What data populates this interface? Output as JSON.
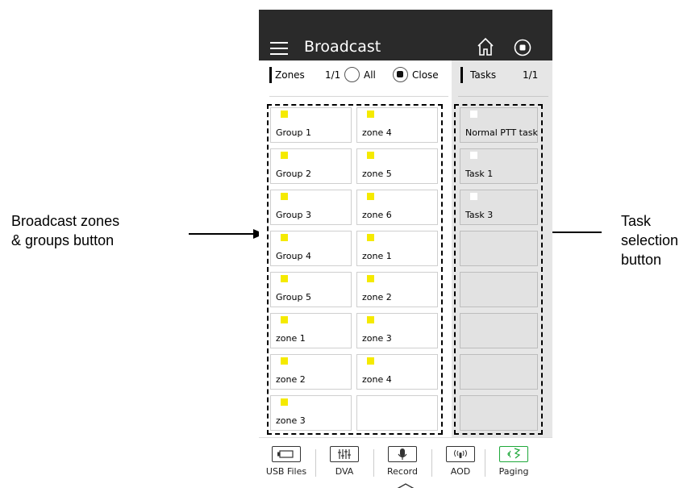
{
  "app": {
    "title": "Broadcast"
  },
  "zones_header": {
    "label": "Zones",
    "page": "1/1",
    "all_label": "All",
    "close_label": "Close"
  },
  "tasks_header": {
    "label": "Tasks",
    "page": "1/1"
  },
  "zone_buttons": [
    {
      "label": "Group 1",
      "indicator_color": "#f5ea00"
    },
    {
      "label": "zone 4",
      "indicator_color": "#f5ea00"
    },
    {
      "label": "Group 2",
      "indicator_color": "#f5ea00"
    },
    {
      "label": "zone 5",
      "indicator_color": "#f5ea00"
    },
    {
      "label": "Group 3",
      "indicator_color": "#f5ea00"
    },
    {
      "label": "zone 6",
      "indicator_color": "#f5ea00"
    },
    {
      "label": "Group 4",
      "indicator_color": "#f5ea00"
    },
    {
      "label": "zone 1",
      "indicator_color": "#f5ea00"
    },
    {
      "label": "Group 5",
      "indicator_color": "#f5ea00"
    },
    {
      "label": "zone 2",
      "indicator_color": "#f5ea00"
    },
    {
      "label": "zone 1",
      "indicator_color": "#f5ea00"
    },
    {
      "label": "zone 3",
      "indicator_color": "#f5ea00"
    },
    {
      "label": "zone 2",
      "indicator_color": "#f5ea00"
    },
    {
      "label": "zone 4",
      "indicator_color": "#f5ea00"
    },
    {
      "label": "zone 3",
      "indicator_color": "#f5ea00"
    },
    {
      "label": ""
    }
  ],
  "task_buttons": [
    {
      "label": "Normal PTT task"
    },
    {
      "label": "Task 1"
    },
    {
      "label": "Task 3"
    },
    {
      "label": ""
    },
    {
      "label": ""
    },
    {
      "label": ""
    },
    {
      "label": ""
    },
    {
      "label": ""
    }
  ],
  "bottom_nav": [
    {
      "label": "USB Files",
      "icon": "usb-drive-icon"
    },
    {
      "label": "DVA",
      "icon": "mixer-sliders-icon"
    },
    {
      "label": "Record",
      "icon": "microphone-icon"
    },
    {
      "label": "AOD",
      "icon": "audio-on-demand-icon"
    },
    {
      "label": "Paging",
      "icon": "paging-speaker-icon",
      "active": true
    }
  ],
  "annotations": {
    "left": "Broadcast zones\n& groups button",
    "right": "Task\nselection\nbutton"
  },
  "colors": {
    "accent_active": "#1ea83a",
    "zone_indicator": "#f5ea00",
    "topbar": "#2a2a2a",
    "tasks_bg": "#e6e6e6"
  }
}
